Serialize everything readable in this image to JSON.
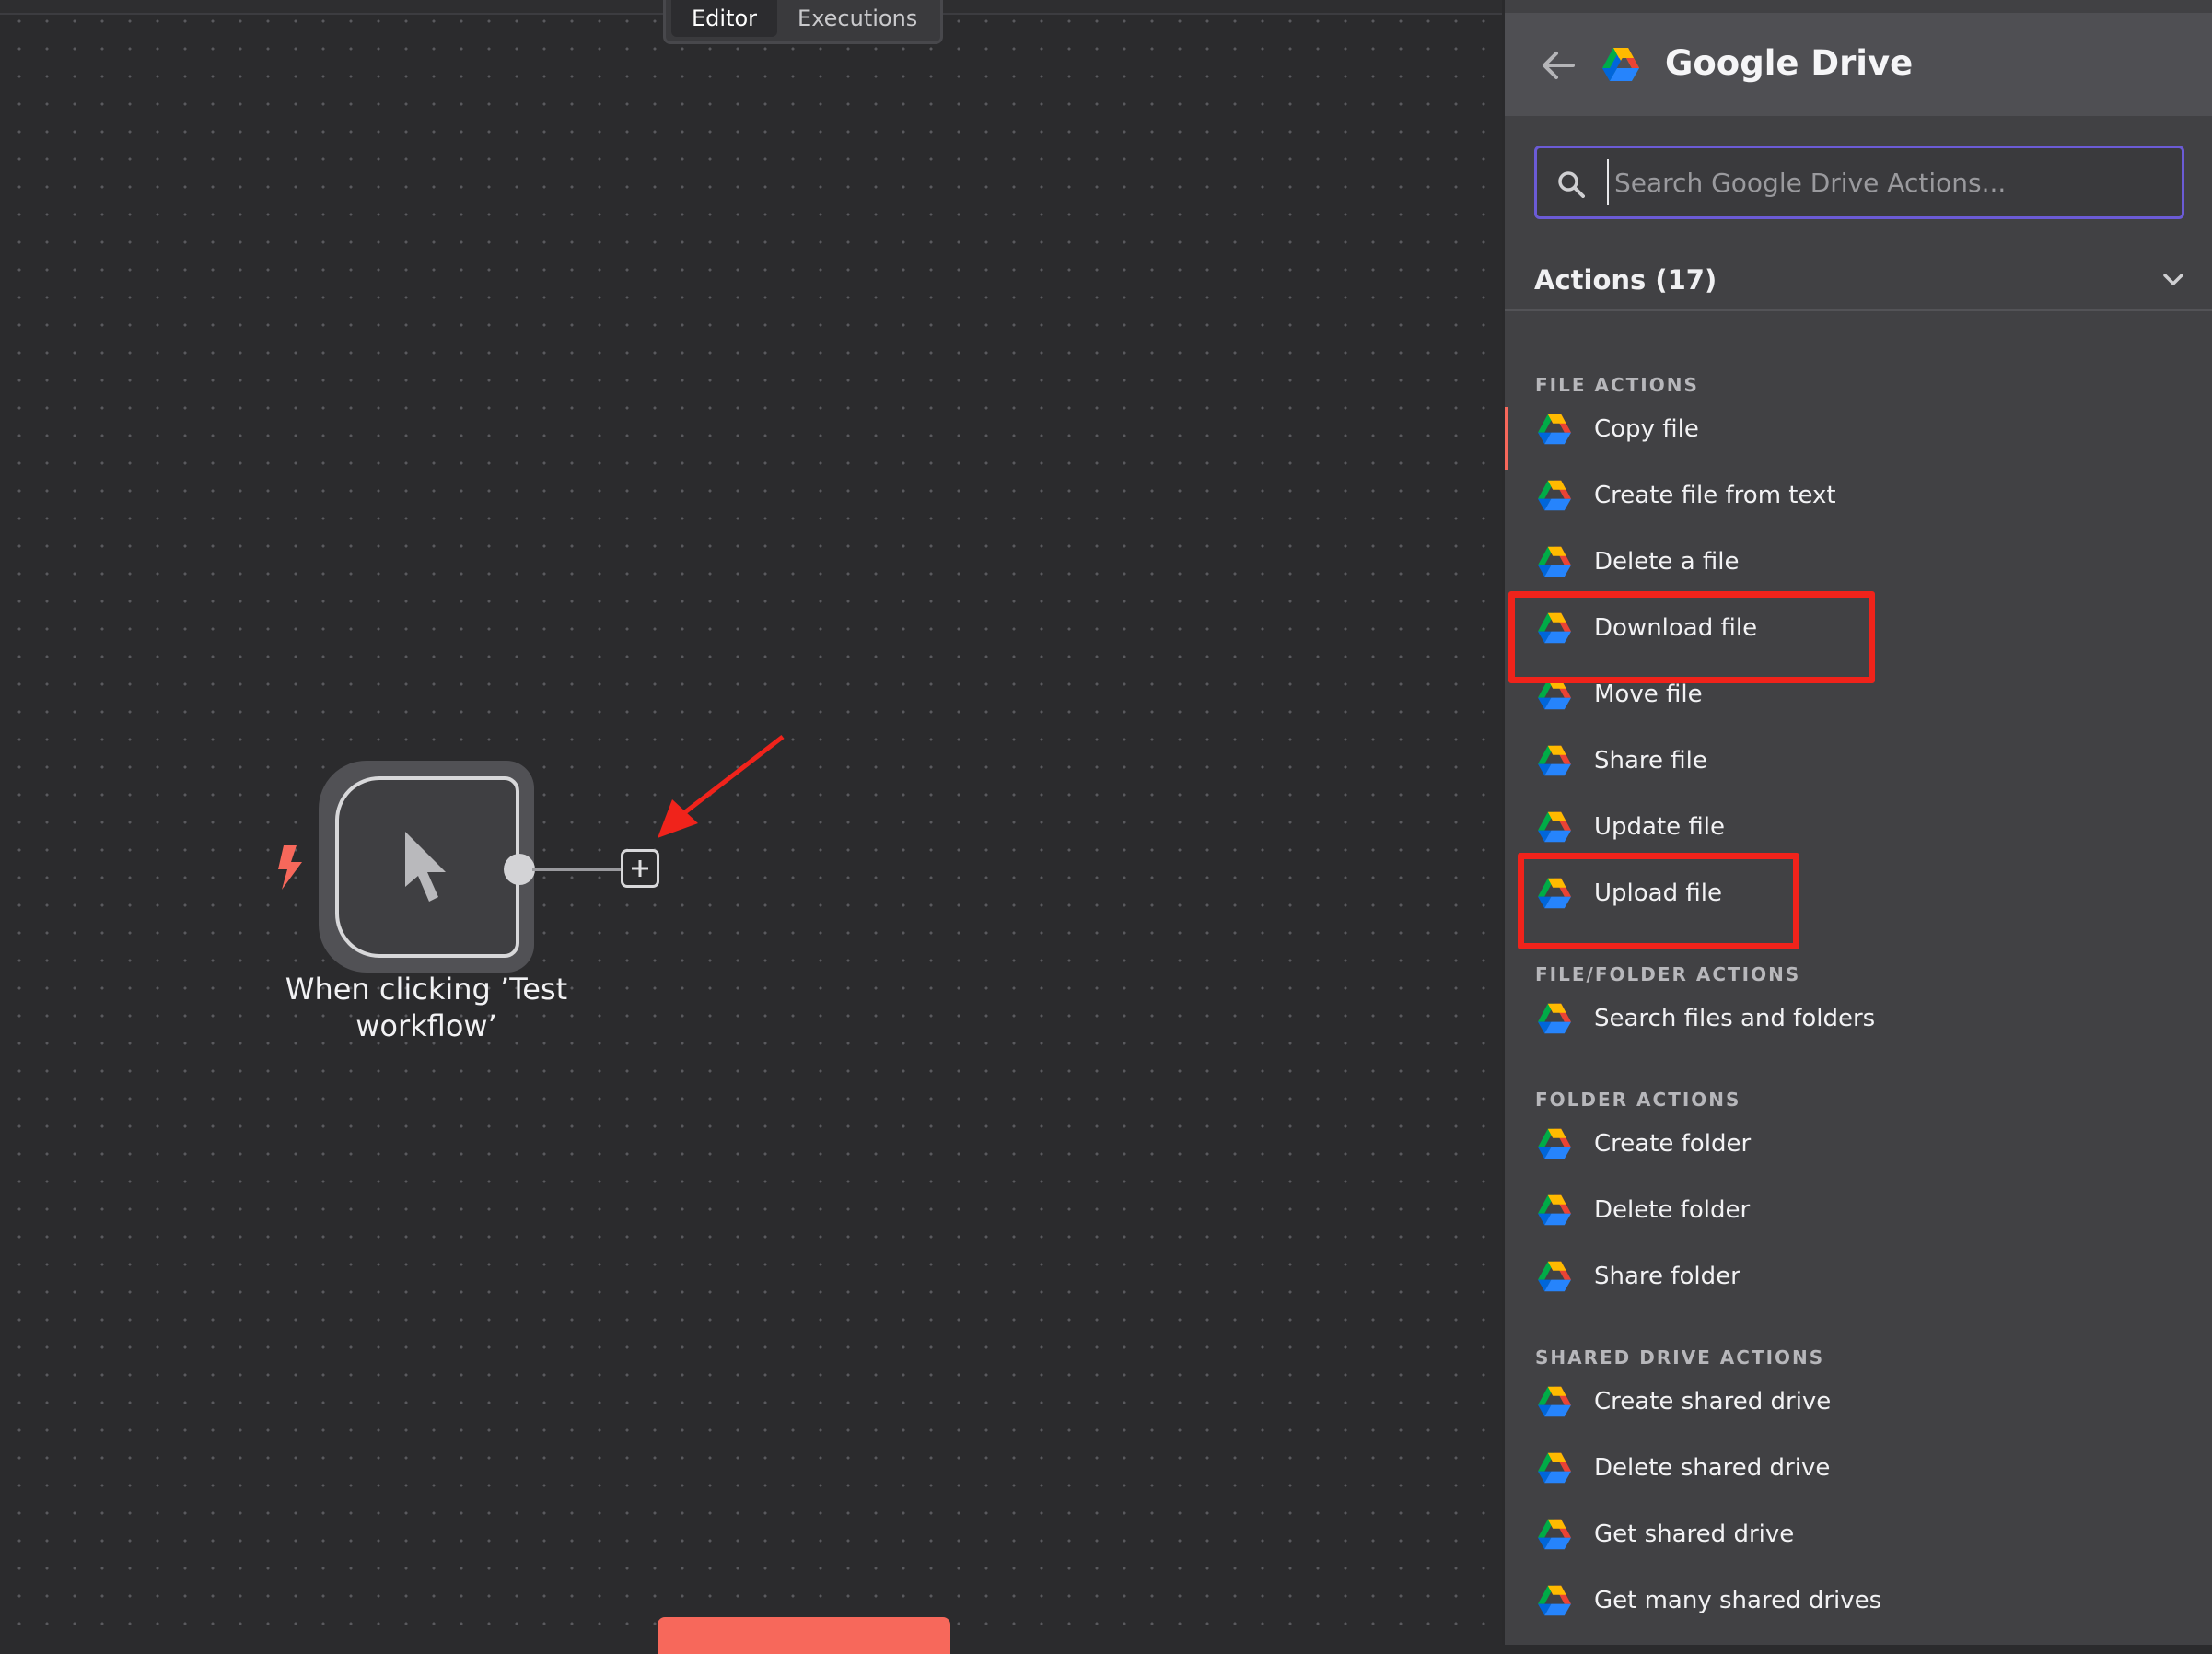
{
  "canvas": {
    "tabs": [
      {
        "label": "Editor",
        "active": true
      },
      {
        "label": "Executions",
        "active": false
      }
    ],
    "trigger_node": {
      "label": "When clicking ’Test workflow’",
      "icon": "cursor-pointer-icon"
    },
    "add_node_icon": "plus-icon",
    "trigger_icon": "lightning-bolt-icon"
  },
  "panel": {
    "title": "Google Drive",
    "back_icon": "arrow-left-icon",
    "search": {
      "placeholder": "Search Google Drive Actions...",
      "value": ""
    },
    "actions_header": "Actions (17)",
    "sections": [
      {
        "label": "FILE ACTIONS",
        "items": [
          "Copy file",
          "Create file from text",
          "Delete a file",
          "Download file",
          "Move file",
          "Share file",
          "Update file",
          "Upload file"
        ]
      },
      {
        "label": "FILE/FOLDER ACTIONS",
        "items": [
          "Search files and folders"
        ]
      },
      {
        "label": "FOLDER ACTIONS",
        "items": [
          "Create folder",
          "Delete folder",
          "Share folder"
        ]
      },
      {
        "label": "SHARED DRIVE ACTIONS",
        "items": [
          "Create shared drive",
          "Delete shared drive",
          "Get shared drive",
          "Get many shared drives"
        ]
      }
    ]
  },
  "colors": {
    "accent": "#f7685b",
    "highlight": "#f0231b",
    "search_border": "#6b5bd6"
  }
}
